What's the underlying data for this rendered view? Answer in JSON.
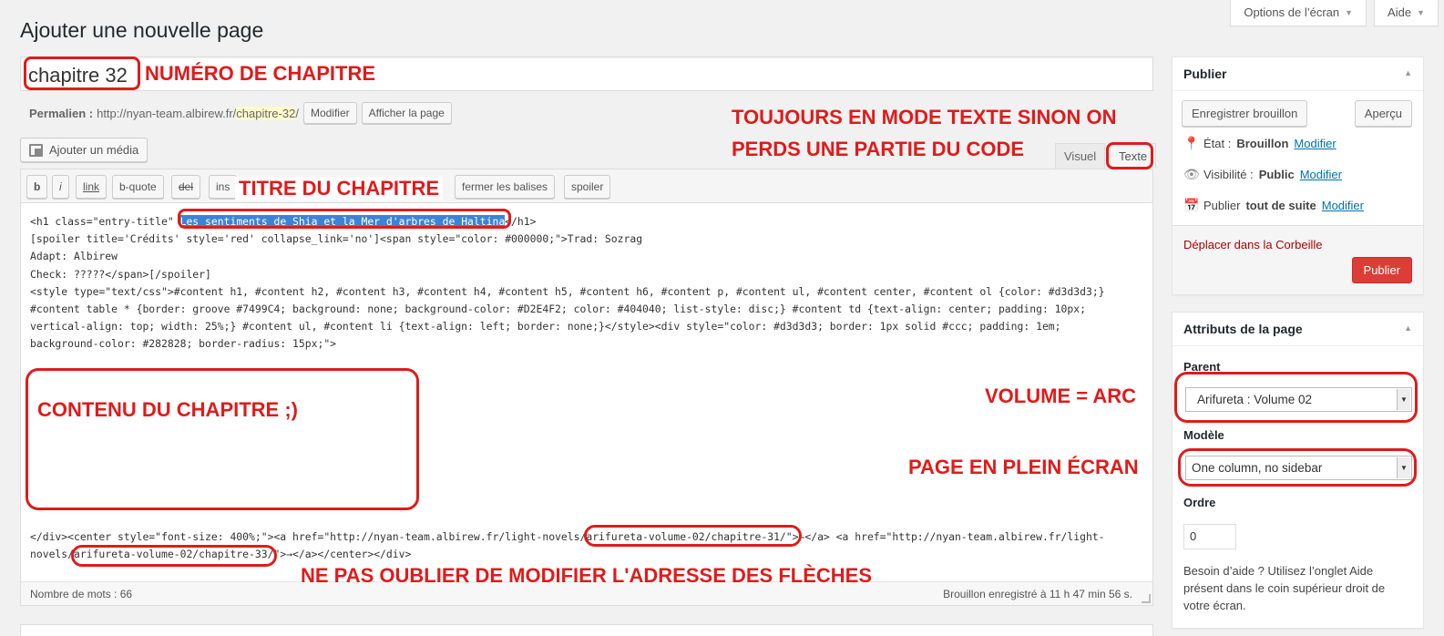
{
  "screen_meta": {
    "options_label": "Options de l’écran",
    "help_label": "Aide"
  },
  "page": {
    "heading": "Ajouter une nouvelle page"
  },
  "title": {
    "value": "chapitre 32"
  },
  "permalink": {
    "label": "Permalien :",
    "base": "http://nyan-team.albirew.fr/",
    "slug": "chapitre-32",
    "suffix": "/",
    "edit_label": "Modifier",
    "view_label": "Afficher la page"
  },
  "editor": {
    "add_media": "Ajouter un média",
    "tabs": {
      "visual": "Visuel",
      "text": "Texte"
    },
    "toolbar": [
      "b",
      "i",
      "link",
      "b-quote",
      "del",
      "ins",
      "fermer les balises",
      "spoiler"
    ],
    "code_top": {
      "prefix": "<h1 class=\"entry-title\" ",
      "selected": "Les sentiments de Shia et la Mer d'arbres de Haltina",
      "rest": "</h1>\n[spoiler title='Crédits' style='red' collapse_link='no']<span style=\"color: #000000;\">Trad: Sozrag\nAdapt: Albirew\nCheck: ?????</span>[/spoiler]\n<style type=\"text/css\">#content h1, #content h2, #content h3, #content h4, #content h5, #content h6, #content p, #content ul, #content center, #content ol {color: #d3d3d3;}\n#content table * {border: groove #7499C4; background: none; background-color: #D2E4F2; color: #404040; list-style: disc;} #content td {text-align: center; padding: 10px;\nvertical-align: top; width: 25%;} #content ul, #content li {text-align: left; border: none;}</style><div style=\"color: #d3d3d3; border: 1px solid #ccc; padding: 1em;\nbackground-color: #282828; border-radius: 15px;\">"
    },
    "code_bottom": "</div><center style=\"font-size: 400%;\"><a href=\"http://nyan-team.albirew.fr/light-novels/arifureta-volume-02/chapitre-31/\">←</a> <a href=\"http://nyan-team.albirew.fr/light-\nnovels/arifureta-volume-02/chapitre-33/\">→</a></center></div>",
    "word_count": "Nombre de mots : 66",
    "saved_status": "Brouillon enregistré à 11 h 47 min 56 s."
  },
  "publish_box": {
    "title": "Publier",
    "save_draft": "Enregistrer brouillon",
    "preview": "Aperçu",
    "status_label": "État :",
    "status_value": "Brouillon",
    "visibility_label": "Visibilité :",
    "visibility_value": "Public",
    "schedule_label": "Publier",
    "schedule_value": "tout de suite",
    "edit_link": "Modifier",
    "trash": "Déplacer dans la Corbeille",
    "publish": "Publier"
  },
  "attributes_box": {
    "title": "Attributs de la page",
    "parent_label": "Parent",
    "parent_value": "Arifureta : Volume 02",
    "template_label": "Modèle",
    "template_value": "One column, no sidebar",
    "order_label": "Ordre",
    "order_value": "0",
    "help_text": "Besoin d’aide ? Utilisez l’onglet Aide présent dans le coin supérieur droit de votre écran."
  },
  "annotations": {
    "chapter_number": "NUMÉRO DE CHAPITRE",
    "text_mode_1": "TOUJOURS EN MODE TEXTE SINON ON",
    "text_mode_2": "PERDS UNE PARTIE DU CODE",
    "chapter_title": "TITRE DU CHAPITRE",
    "chapter_content": "CONTENU DU CHAPITRE ;)",
    "volume_arc": "VOLUME = ARC",
    "fullscreen": "PAGE EN PLEIN ÉCRAN",
    "arrows": "NE PAS OUBLIER DE MODIFIER L'ADRESSE DES FLÈCHES"
  },
  "colors": {
    "annotation": "#e01b1b",
    "publish_button": "#dd3d36",
    "link": "#0073aa",
    "selection": "#3b83d8"
  }
}
